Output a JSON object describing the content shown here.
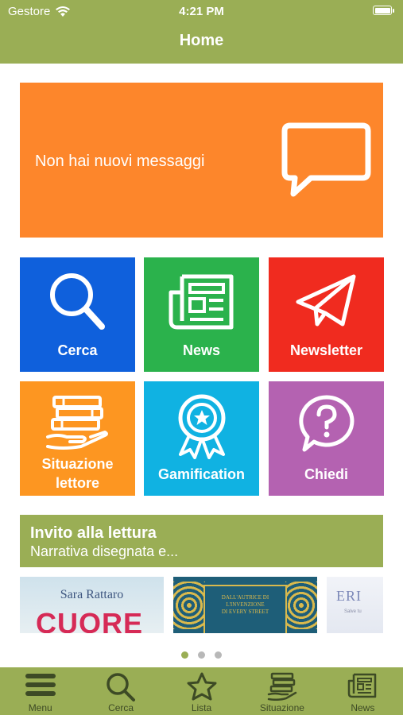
{
  "status_bar": {
    "carrier": "Gestore",
    "time": "4:21 PM"
  },
  "nav": {
    "title": "Home"
  },
  "messages": {
    "text": "Non hai nuovi messaggi",
    "icon": "chat-bubble-icon"
  },
  "tiles": [
    {
      "label": "Cerca",
      "icon": "search-icon",
      "color": "#0f60dc"
    },
    {
      "label": "News",
      "icon": "newspaper-icon",
      "color": "#2bb24c"
    },
    {
      "label": "Newsletter",
      "icon": "paper-plane-icon",
      "color": "#f02b1f"
    },
    {
      "label": "Situazione lettore",
      "line1": "Situazione",
      "line2": "lettore",
      "icon": "books-hand-icon",
      "color": "#fd9621"
    },
    {
      "label": "Gamification",
      "icon": "award-ribbon-icon",
      "color": "#10b2e2"
    },
    {
      "label": "Chiedi",
      "icon": "question-bubble-icon",
      "color": "#b462b1"
    }
  ],
  "invito": {
    "title": "Invito alla lettura",
    "subtitle": "Narrativa disegnata e..."
  },
  "carousel": {
    "covers": [
      {
        "author": "Sara Rattaro",
        "title": "CUORE"
      },
      {
        "text1": "DALL'AUTRICE DI",
        "text2": "L'INVENZIONE",
        "text3": "DI EVERY STREET"
      },
      {
        "title": "ERI",
        "subtitle": "Salve tu"
      }
    ],
    "dots": 3,
    "active_dot": 0
  },
  "tabbar": {
    "items": [
      {
        "label": "Menu",
        "icon": "hamburger-icon"
      },
      {
        "label": "Cerca",
        "icon": "search-icon"
      },
      {
        "label": "Lista",
        "icon": "star-icon"
      },
      {
        "label": "Situazione",
        "icon": "books-hand-icon"
      },
      {
        "label": "News",
        "icon": "newspaper-icon"
      }
    ]
  },
  "colors": {
    "brand_green": "#9aae55",
    "message_orange": "#fd862b"
  }
}
